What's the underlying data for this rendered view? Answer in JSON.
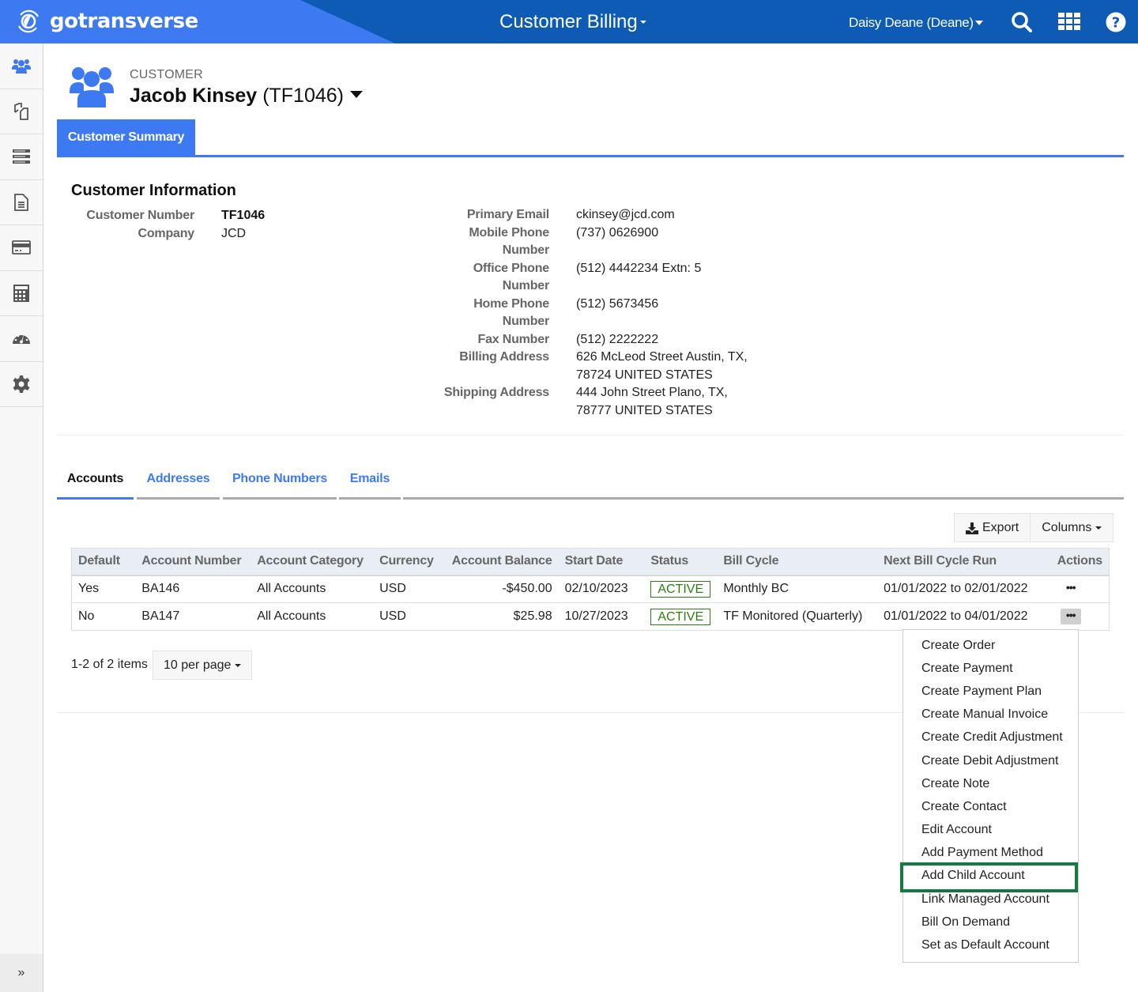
{
  "topbar": {
    "brand": "gotransverse",
    "app_title": "Customer Billing",
    "user": "Daisy Deane (Deane)",
    "icons": [
      "search-icon",
      "apps-grid-icon",
      "help-icon"
    ],
    "colors": {
      "brand_blue": "#3d7af2",
      "bar_blue": "#0d5bb5"
    }
  },
  "sidebar": {
    "items": [
      {
        "icon": "customers-icon",
        "active": true
      },
      {
        "icon": "orders-icon"
      },
      {
        "icon": "server-list-icon"
      },
      {
        "icon": "document-icon"
      },
      {
        "icon": "credit-card-icon"
      },
      {
        "icon": "calculator-icon"
      },
      {
        "icon": "dashboard-gauge-icon"
      },
      {
        "icon": "gear-icon"
      }
    ],
    "expand_label": "»"
  },
  "header": {
    "label": "CUSTOMER",
    "name": "Jacob Kinsey",
    "id": "(TF1046)",
    "tab": "Customer Summary"
  },
  "customer_info": {
    "title": "Customer Information",
    "left": [
      {
        "label": "Customer Number",
        "value": "TF1046"
      },
      {
        "label": "Company",
        "value": "JCD"
      }
    ],
    "right": [
      {
        "label": "Primary Email",
        "value": "ckinsey@jcd.com"
      },
      {
        "label": "Mobile Phone Number",
        "value": "(737) 0626900"
      },
      {
        "label": "Office Phone Number",
        "value": "(512) 4442234 Extn: 5"
      },
      {
        "label": "Home Phone Number",
        "value": "(512) 5673456"
      },
      {
        "label": "Fax Number",
        "value": "(512) 2222222"
      },
      {
        "label": "Billing Address",
        "value": "626 McLeod Street Austin, TX, 78724 UNITED STATES"
      },
      {
        "label": "Shipping Address",
        "value": "444 John Street Plano, TX, 78777 UNITED STATES"
      }
    ]
  },
  "subtabs": [
    "Accounts",
    "Addresses",
    "Phone Numbers",
    "Emails"
  ],
  "toolbar": {
    "export": "Export",
    "columns": "Columns"
  },
  "accounts_table": {
    "columns": [
      "Default",
      "Account Number",
      "Account Category",
      "Currency",
      "Account Balance",
      "Start Date",
      "Status",
      "Bill Cycle",
      "Next Bill Cycle Run",
      "Actions"
    ],
    "rows": [
      {
        "default": "Yes",
        "number": "BA146",
        "category": "All Accounts",
        "currency": "USD",
        "balance": "-$450.00",
        "start": "02/10/2023",
        "status": "ACTIVE",
        "bill_cycle": "Monthly BC",
        "next_run": "01/01/2022 to 02/01/2022"
      },
      {
        "default": "No",
        "number": "BA147",
        "category": "All Accounts",
        "currency": "USD",
        "balance": "$25.98",
        "start": "10/27/2023",
        "status": "ACTIVE",
        "bill_cycle": "TF Monitored (Quarterly)",
        "next_run": "01/01/2022 to 04/01/2022"
      }
    ]
  },
  "pager": {
    "summary": "1-2 of 2 items",
    "per_page": "10 per page"
  },
  "actions_menu": {
    "items": [
      "Create Order",
      "Create Payment",
      "Create Payment Plan",
      "Create Manual Invoice",
      "Create Credit Adjustment",
      "Create Debit Adjustment",
      "Create Note",
      "Create Contact",
      "Edit Account",
      "Add Payment Method",
      "Add Child Account",
      "Link Managed Account",
      "Bill On Demand",
      "Set as Default Account"
    ],
    "highlighted": "Add Child Account",
    "highlight_color": "#137b3f"
  }
}
